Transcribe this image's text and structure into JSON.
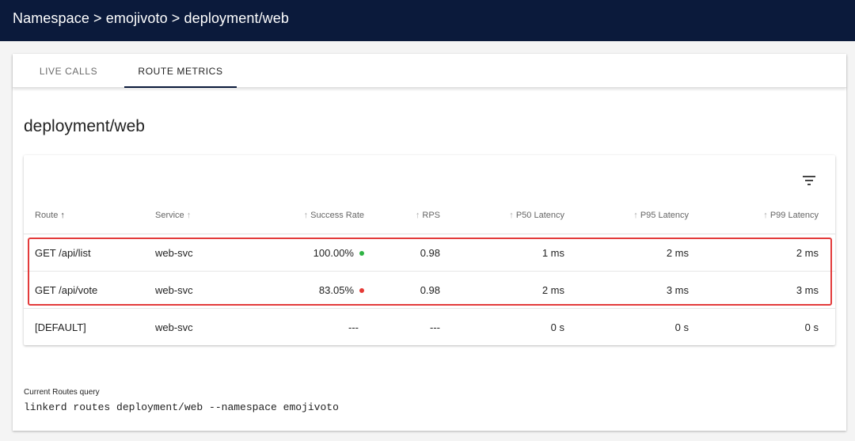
{
  "breadcrumb": {
    "text": "Namespace > emojivoto > deployment/web"
  },
  "tabs": [
    {
      "label": "LIVE CALLS",
      "active": false
    },
    {
      "label": "ROUTE METRICS",
      "active": true
    }
  ],
  "page_title": "deployment/web",
  "table": {
    "filter_icon": "filter-list-icon",
    "columns": [
      {
        "label": "Route",
        "sort_arrow": "↑"
      },
      {
        "label": "Service",
        "sort_arrow": "↑"
      },
      {
        "label": "Success Rate",
        "sort_arrow": "↑"
      },
      {
        "label": "RPS",
        "sort_arrow": "↑"
      },
      {
        "label": "P50 Latency",
        "sort_arrow": "↑"
      },
      {
        "label": "P95 Latency",
        "sort_arrow": "↑"
      },
      {
        "label": "P99 Latency",
        "sort_arrow": "↑"
      }
    ],
    "rows": [
      {
        "route": "GET /api/list",
        "service": "web-svc",
        "success_rate": "100.00%",
        "status_color": "#2fb344",
        "rps": "0.98",
        "p50": "1 ms",
        "p95": "2 ms",
        "p99": "2 ms"
      },
      {
        "route": "GET /api/vote",
        "service": "web-svc",
        "success_rate": "83.05%",
        "status_color": "#e53935",
        "rps": "0.98",
        "p50": "2 ms",
        "p95": "3 ms",
        "p99": "3 ms"
      },
      {
        "route": "[DEFAULT]",
        "service": "web-svc",
        "success_rate": "---",
        "status_color": "",
        "rps": "---",
        "p50": "0 s",
        "p95": "0 s",
        "p99": "0 s"
      }
    ]
  },
  "query": {
    "label": "Current Routes query",
    "command": "linkerd routes deployment/web --namespace emojivoto"
  },
  "colors": {
    "topbar": "#0b1a3b",
    "highlight": "#e33b3b",
    "success_green": "#2fb344",
    "error_red": "#e53935"
  }
}
